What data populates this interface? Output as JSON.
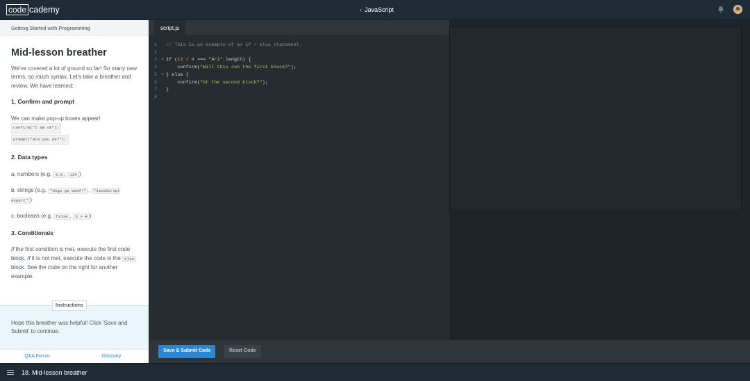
{
  "header": {
    "logo_box": "code",
    "logo_rest": "cademy",
    "course_chevron": "‹",
    "course": "JavaScript",
    "bell_icon": "bell-icon",
    "avatar_icon": "user-avatar"
  },
  "lesson": {
    "header": "Getting Started with Programming",
    "title": "Mid-lesson breather",
    "intro": "We've covered a lot of ground so far! So many new terms, so much syntax. Let's take a breather and review. We have learned:",
    "s1_heading": "1. Confirm and prompt",
    "s1_text": "We can make pop-up boxes appear!",
    "s1_code1": "confirm(\"I am ok\");",
    "s1_code2": "prompt(\"Are you ok?\");",
    "s2_heading": "2. Data types",
    "s2_a_prefix": "a. numbers (e.g.",
    "s2_a_code1": "4.3",
    "s2_a_code2": "134",
    "s2_a_suffix": ")",
    "s2_b_prefix": "b. strings (e.g.",
    "s2_b_code1": "\"dogs go woof!\"",
    "s2_b_code2": "\"JavaScript expert\"",
    "s2_b_suffix": ")",
    "s2_c_prefix": "c. booleans (e.g.",
    "s2_c_code1": "false",
    "s2_c_code2": "5 > 4",
    "s2_c_suffix": ")",
    "s3_heading": "3. Conditionals",
    "s3_if": "If",
    "s3_part1": " the first condition is met, execute the first code block. ",
    "s3_if2": "If",
    "s3_part2": " it is not met, execute the code in the ",
    "s3_code": "else",
    "s3_part3": " block. See the code on the right for another example."
  },
  "instructions": {
    "tab": "Instructions",
    "text": "Hope this breather was helpful! Click 'Save and Submit' to continue."
  },
  "footer_links": {
    "qa": "Q&A Forum",
    "glossary": "Glossary"
  },
  "editor": {
    "filename": "script.js",
    "lines": [
      {
        "n": "1",
        "fold": "",
        "segs": [
          [
            "c-com",
            "// This is an example of an if / else statement."
          ]
        ]
      },
      {
        "n": "2",
        "fold": "",
        "segs": []
      },
      {
        "n": "3",
        "fold": "▾",
        "segs": [
          [
            "c-key",
            "if "
          ],
          [
            "c-txt",
            "("
          ],
          [
            "c-num",
            "12"
          ],
          [
            "c-txt",
            " / "
          ],
          [
            "c-num",
            "4"
          ],
          [
            "c-txt",
            " === "
          ],
          [
            "c-str",
            "\"Ari\""
          ],
          [
            "c-txt",
            ".length) {"
          ]
        ]
      },
      {
        "n": "4",
        "fold": "",
        "segs": [
          [
            "c-txt",
            "    confirm("
          ],
          [
            "c-str",
            "\"Will this run the first block?\""
          ],
          [
            "c-txt",
            ");"
          ]
        ]
      },
      {
        "n": "5",
        "fold": "▾",
        "segs": [
          [
            "c-txt",
            "} "
          ],
          [
            "c-key",
            "else"
          ],
          [
            "c-txt",
            " {"
          ]
        ]
      },
      {
        "n": "6",
        "fold": "",
        "segs": [
          [
            "c-txt",
            "    confirm("
          ],
          [
            "c-str",
            "\"Or the second block?\""
          ],
          [
            "c-txt",
            ");"
          ]
        ]
      },
      {
        "n": "7",
        "fold": "",
        "segs": [
          [
            "c-txt",
            "}"
          ]
        ]
      },
      {
        "n": "8",
        "fold": "",
        "segs": []
      }
    ]
  },
  "actions": {
    "save": "Save & Submit Code",
    "reset": "Reset Code"
  },
  "lesson_bar": {
    "menu_icon": "hamburger-menu-icon",
    "title": "18. Mid-lesson breather"
  },
  "colors": {
    "accent": "#2b87d1",
    "topbar": "#1f2c38",
    "editor_bg": "#272c31"
  }
}
